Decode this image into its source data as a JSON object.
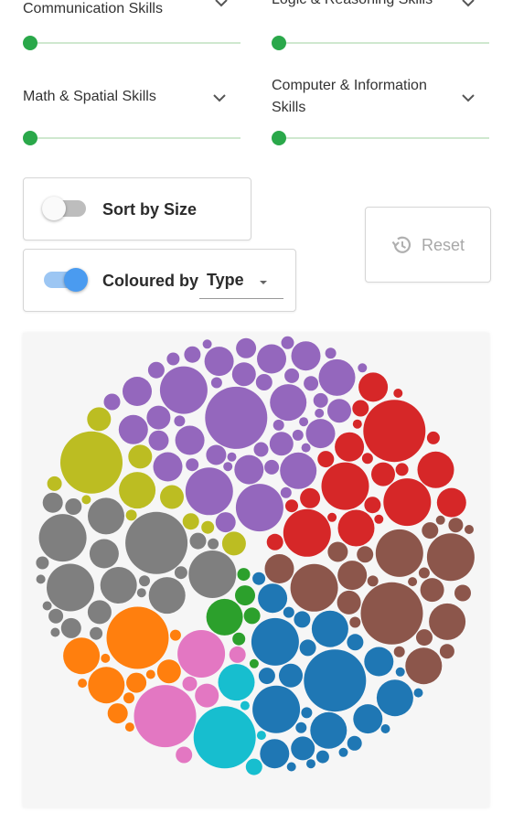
{
  "skills": [
    {
      "label_lines": [
        "Communication Skills"
      ],
      "value": 0
    },
    {
      "label_lines": [
        "Logic & Reasoning Skills"
      ],
      "value": 0
    },
    {
      "label_lines": [
        "Math & Spatial Skills"
      ],
      "value": 0
    },
    {
      "label_lines": [
        "Computer & Information",
        "Skills"
      ],
      "value": 0
    }
  ],
  "controls": {
    "sort_label": "Sort by Size",
    "sort_on": false,
    "colour_label": "Coloured by",
    "colour_select_value": "Type",
    "colour_on": true,
    "reset_label": "Reset"
  },
  "colors": {
    "slider_thumb": "#2aa84a",
    "slider_track": "#cfe8cf",
    "switch_on": "#4a9bf0",
    "switch_off": "#bdbdbd"
  },
  "icons": {
    "dropdown": "chevron-down-icon",
    "select_caret": "caret-down-icon",
    "reset": "history-icon"
  },
  "chart_data": {
    "type": "bubble-pack",
    "groups": [
      {
        "color": "#9467bd"
      },
      {
        "color": "#d62728"
      },
      {
        "color": "#8c564b"
      },
      {
        "color": "#1f77b4"
      },
      {
        "color": "#17becf"
      },
      {
        "color": "#e377c2"
      },
      {
        "color": "#ff7f0e"
      },
      {
        "color": "#7f7f7f"
      },
      {
        "color": "#bcbd22"
      },
      {
        "color": "#2ca02c"
      }
    ]
  }
}
